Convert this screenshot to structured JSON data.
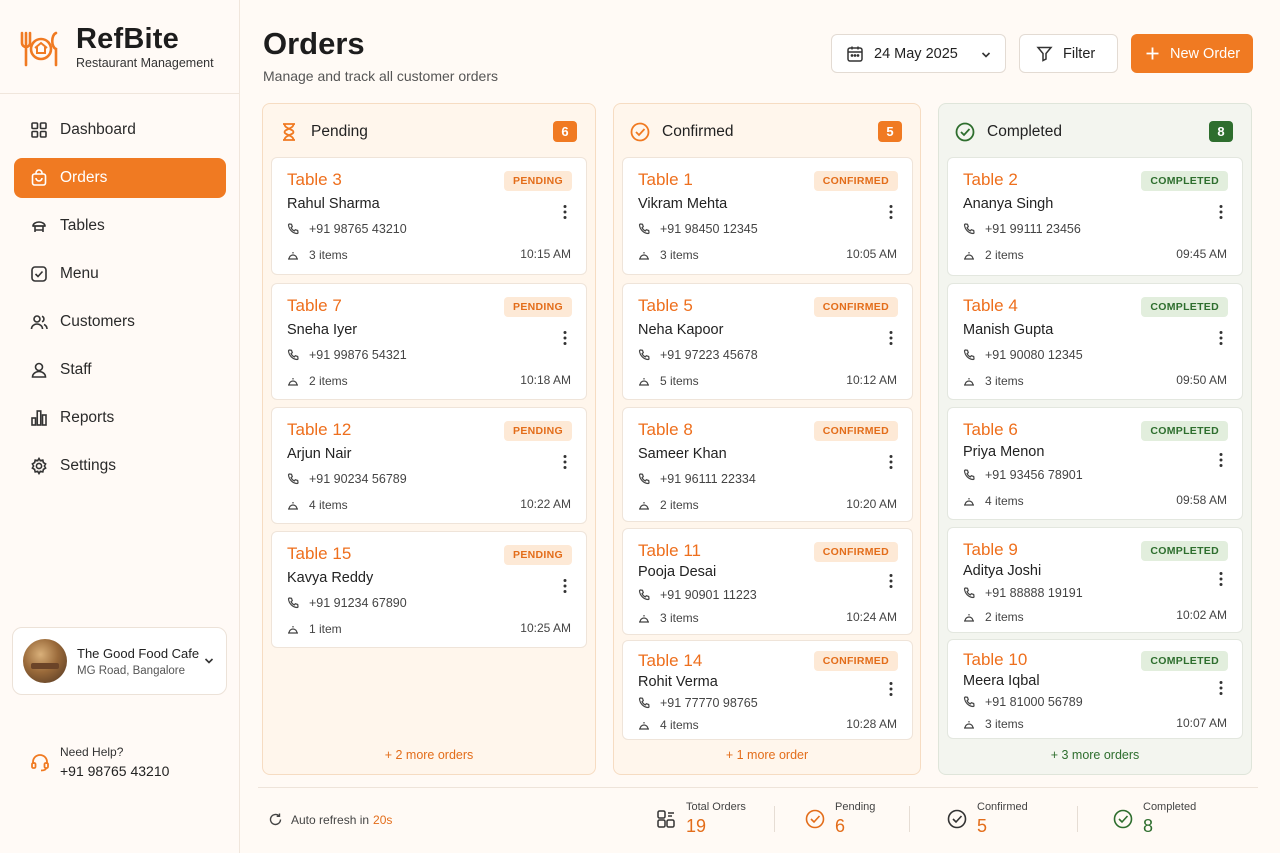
{
  "brand": {
    "name": "RefBite",
    "subtitle": "Restaurant Management"
  },
  "nav": [
    {
      "label": "Dashboard",
      "icon": "grid-icon",
      "active": false
    },
    {
      "label": "Orders",
      "icon": "bag-icon",
      "active": true
    },
    {
      "label": "Tables",
      "icon": "table-icon",
      "active": false
    },
    {
      "label": "Menu",
      "icon": "menu-check-icon",
      "active": false
    },
    {
      "label": "Customers",
      "icon": "users-icon",
      "active": false
    },
    {
      "label": "Staff",
      "icon": "staff-icon",
      "active": false
    },
    {
      "label": "Reports",
      "icon": "bar-chart-icon",
      "active": false
    },
    {
      "label": "Settings",
      "icon": "gear-icon",
      "active": false
    }
  ],
  "venue": {
    "name": "The Good Food Cafe",
    "location": "MG Road, Bangalore"
  },
  "help": {
    "label": "Need Help?",
    "phone": "+91 98765 43210"
  },
  "header": {
    "title": "Orders",
    "subtitle": "Manage and track all customer orders",
    "date": "24 May 2025",
    "filter_label": "Filter",
    "new_order_label": "New Order"
  },
  "columns": [
    {
      "key": "pending",
      "title": "Pending",
      "count": "6",
      "badge": "PENDING",
      "more": "+ 2 more orders",
      "accent": "#f07a22",
      "orders": [
        {
          "table": "Table 3",
          "name": "Rahul Sharma",
          "phone": "+91 98765 43210",
          "items": "3 items",
          "time": "10:15 AM"
        },
        {
          "table": "Table 7",
          "name": "Sneha Iyer",
          "phone": "+91 99876 54321",
          "items": "2 items",
          "time": "10:18 AM"
        },
        {
          "table": "Table 12",
          "name": "Arjun Nair",
          "phone": "+91 90234 56789",
          "items": "4 items",
          "time": "10:22 AM"
        },
        {
          "table": "Table 15",
          "name": "Kavya Reddy",
          "phone": "+91 91234 67890",
          "items": "1 item",
          "time": "10:25 AM"
        }
      ]
    },
    {
      "key": "confirmed",
      "title": "Confirmed",
      "count": "5",
      "badge": "CONFIRMED",
      "more": "+ 1 more order",
      "accent": "#f07a22",
      "orders": [
        {
          "table": "Table 1",
          "name": "Vikram Mehta",
          "phone": "+91 98450 12345",
          "items": "3 items",
          "time": "10:05 AM"
        },
        {
          "table": "Table 5",
          "name": "Neha Kapoor",
          "phone": "+91 97223 45678",
          "items": "5 items",
          "time": "10:12 AM"
        },
        {
          "table": "Table 8",
          "name": "Sameer Khan",
          "phone": "+91 96111 22334",
          "items": "2 items",
          "time": "10:20 AM"
        },
        {
          "table": "Table 11",
          "name": "Pooja Desai",
          "phone": "+91 90901 11223",
          "items": "3 items",
          "time": "10:24 AM"
        },
        {
          "table": "Table 14",
          "name": "Rohit Verma",
          "phone": "+91 77770 98765",
          "items": "4 items",
          "time": "10:28 AM"
        }
      ]
    },
    {
      "key": "completed",
      "title": "Completed",
      "count": "8",
      "badge": "COMPLETED",
      "more": "+ 3 more orders",
      "accent": "#2e6e2e",
      "orders": [
        {
          "table": "Table 2",
          "name": "Ananya Singh",
          "phone": "+91 99111 23456",
          "items": "2 items",
          "time": "09:45 AM"
        },
        {
          "table": "Table 4",
          "name": "Manish Gupta",
          "phone": "+91 90080 12345",
          "items": "3 items",
          "time": "09:50 AM"
        },
        {
          "table": "Table 6",
          "name": "Priya Menon",
          "phone": "+91 93456 78901",
          "items": "4 items",
          "time": "09:58 AM"
        },
        {
          "table": "Table 9",
          "name": "Aditya Joshi",
          "phone": "+91 88888 19191",
          "items": "2 items",
          "time": "10:02 AM"
        },
        {
          "table": "Table 10",
          "name": "Meera Iqbal",
          "phone": "+91 81000 56789",
          "items": "3 items",
          "time": "10:07 AM"
        }
      ]
    }
  ],
  "footer": {
    "refresh_prefix": "Auto refresh in",
    "refresh_seconds": "20s",
    "stats": [
      {
        "label": "Total Orders",
        "value": "19",
        "color": "#e36d1a",
        "icon": "orders-icon"
      },
      {
        "label": "Pending",
        "value": "6",
        "color": "#e36d1a",
        "icon": "pending-check-icon"
      },
      {
        "label": "Confirmed",
        "value": "5",
        "color": "#e36d1a",
        "icon": "confirmed-check-icon"
      },
      {
        "label": "Completed",
        "value": "8",
        "color": "#2e6e2e",
        "icon": "completed-check-icon"
      }
    ]
  },
  "colors": {
    "accent": "#f07a22",
    "success": "#2e6e2e"
  }
}
